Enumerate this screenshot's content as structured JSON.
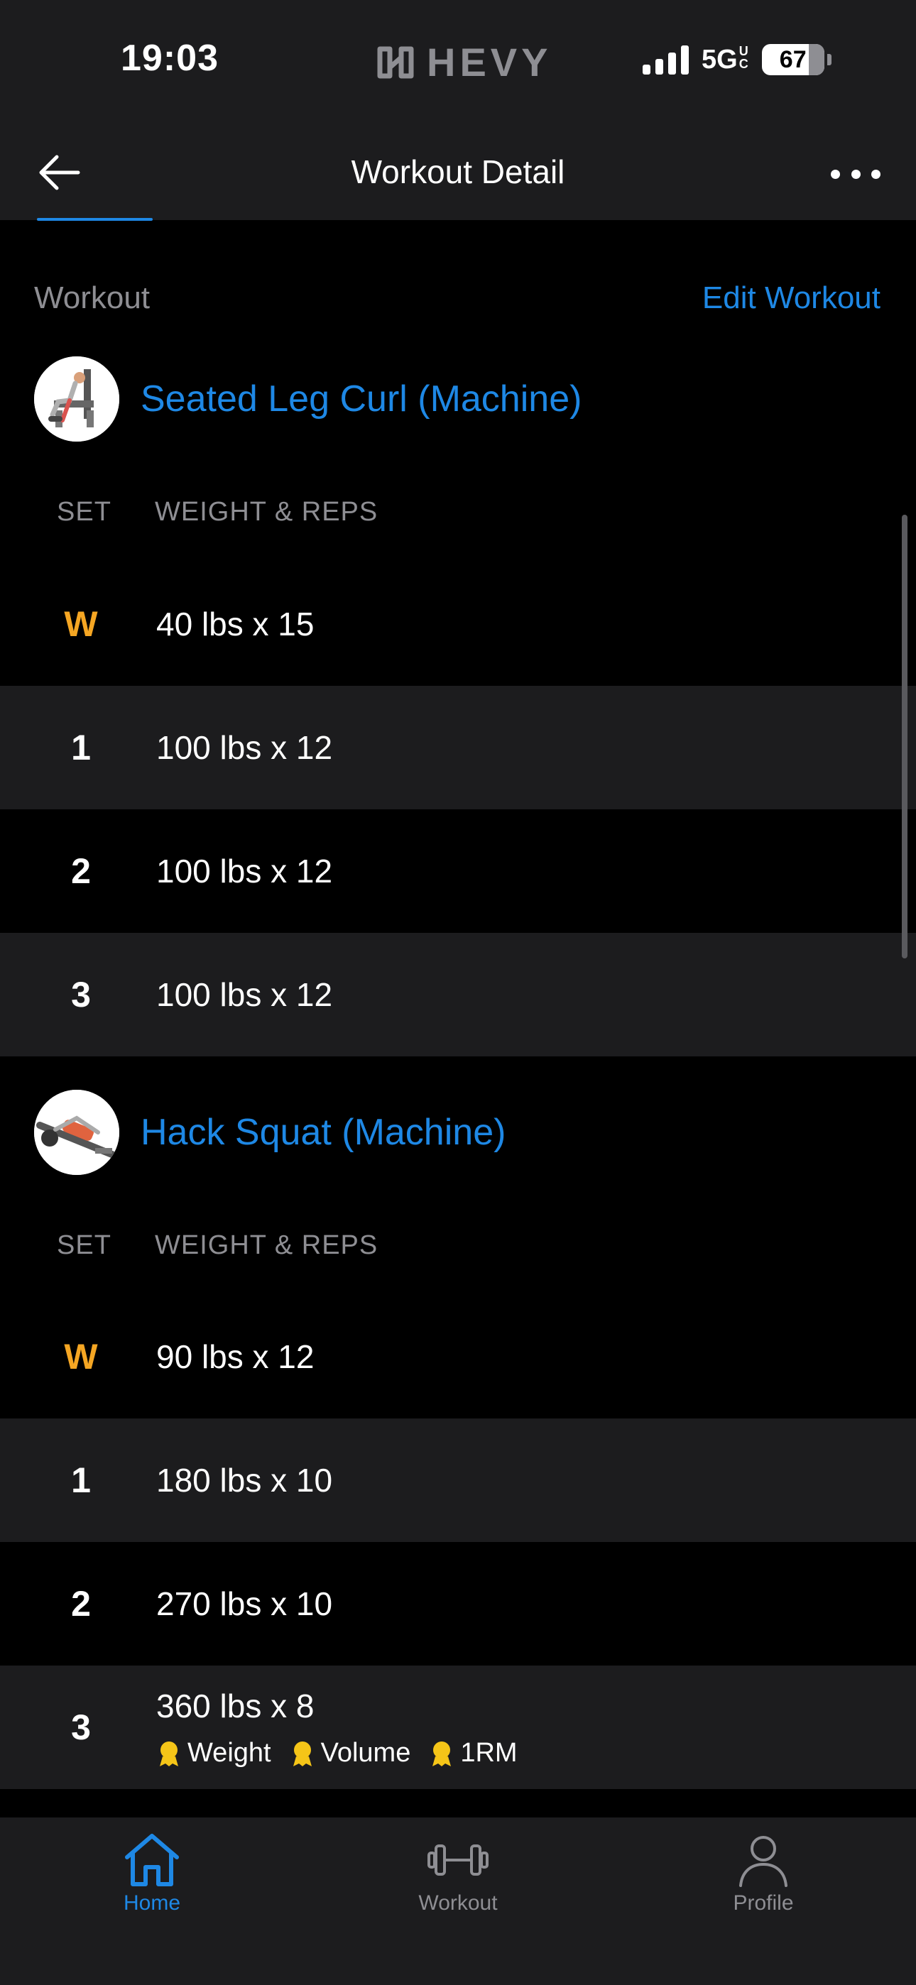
{
  "status_bar": {
    "time": "19:03",
    "logo_text": "HEVY",
    "network": "5G",
    "network_sup": "UC",
    "battery": "67"
  },
  "header": {
    "title": "Workout Detail"
  },
  "section": {
    "label": "Workout",
    "edit_label": "Edit Workout"
  },
  "exercises": [
    {
      "name": "Seated Leg Curl (Machine)",
      "col_set": "SET",
      "col_weight": "WEIGHT & REPS",
      "sets": [
        {
          "set": "W",
          "value": "40 lbs x 15"
        },
        {
          "set": "1",
          "value": "100 lbs x 12"
        },
        {
          "set": "2",
          "value": "100 lbs x 12"
        },
        {
          "set": "3",
          "value": "100 lbs x 12"
        }
      ]
    },
    {
      "name": "Hack Squat (Machine)",
      "col_set": "SET",
      "col_weight": "WEIGHT & REPS",
      "sets": [
        {
          "set": "W",
          "value": "90 lbs x 12"
        },
        {
          "set": "1",
          "value": "180 lbs x 10"
        },
        {
          "set": "2",
          "value": "270 lbs x 10"
        },
        {
          "set": "3",
          "value": "360 lbs x 8",
          "badges": [
            "Weight",
            "Volume",
            "1RM"
          ]
        }
      ]
    }
  ],
  "tabbar": {
    "home": "Home",
    "workout": "Workout",
    "profile": "Profile"
  },
  "colors": {
    "accent": "#1e88e5",
    "warmup": "#f5a623",
    "badge": "#f5c518",
    "surface": "#1c1c1e"
  }
}
